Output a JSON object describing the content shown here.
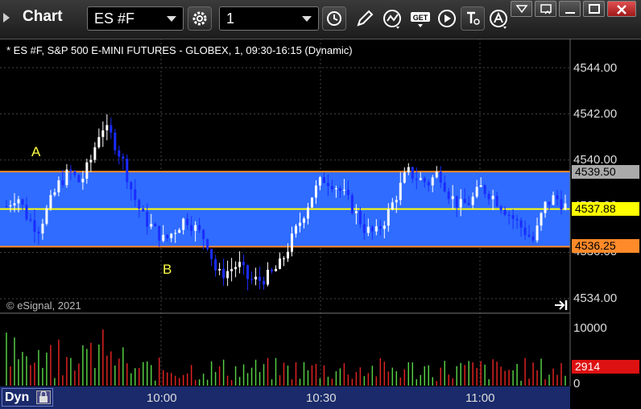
{
  "window": {
    "title": "Chart",
    "symbol_value": "ES #F",
    "interval_value": "1"
  },
  "chart": {
    "title": "* ES #F, S&P 500 E-MINI FUTURES - GLOBEX, 1, 09:30-16:15 (Dynamic)",
    "copyright": "© eSignal, 2021",
    "zone_labels": [
      "A",
      "B"
    ],
    "price_ticks": [
      "4544.00",
      "4542.00",
      "4540.00",
      "4538.00",
      "4536.00",
      "4534.00"
    ],
    "price_tags": {
      "upper": "4539.50",
      "last": "4537.88",
      "lower": "4536.25"
    },
    "volume_ticks": [
      "10000",
      "0"
    ],
    "volume_tag": "2914",
    "time_labels": [
      "10:00",
      "10:30",
      "11:00"
    ],
    "dyn_label": "Dyn"
  },
  "colors": {
    "band": "#2f6cff",
    "band_edge": "#ff8a2a",
    "up_candle": "#ffffff",
    "down_candle": "#1a2cff",
    "last_price": "#ffff00",
    "vol_up": "#55cc44",
    "vol_down": "#dd2222"
  },
  "icons": [
    "dropdown-caret-icon",
    "gear-icon",
    "clock-icon",
    "pencil-icon",
    "study-icon",
    "get-icon",
    "play-icon",
    "text-tool-icon",
    "alert-icon",
    "window-menu-icon",
    "restore-icon",
    "maximize-icon",
    "close-icon",
    "scroll-end-icon",
    "lock-icon"
  ]
}
